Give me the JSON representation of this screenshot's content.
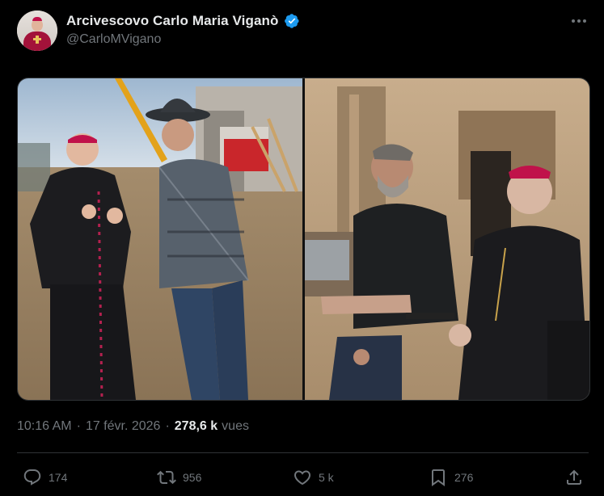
{
  "author": {
    "display_name": "Arcivescovo Carlo Maria Viganò",
    "handle": "@CarloMVigano",
    "verified": true,
    "verified_color": "#1d9bf0"
  },
  "media": {
    "photo_count": 2
  },
  "meta": {
    "time": "10:16 AM",
    "dot": "·",
    "date": "17 févr. 2026",
    "views_count": "278,6 k",
    "views_label": "vues"
  },
  "actions": {
    "replies": "174",
    "reposts": "956",
    "likes": "5 k",
    "bookmarks": "276"
  },
  "icons": {
    "more": "more-horizontal-icon",
    "reply": "reply-icon",
    "repost": "repost-icon",
    "like": "heart-icon",
    "bookmark": "bookmark-icon",
    "share": "share-icon"
  },
  "colors": {
    "background": "#000000",
    "text_primary": "#e7e9ea",
    "text_secondary": "#71767b",
    "border": "#2f3336"
  }
}
